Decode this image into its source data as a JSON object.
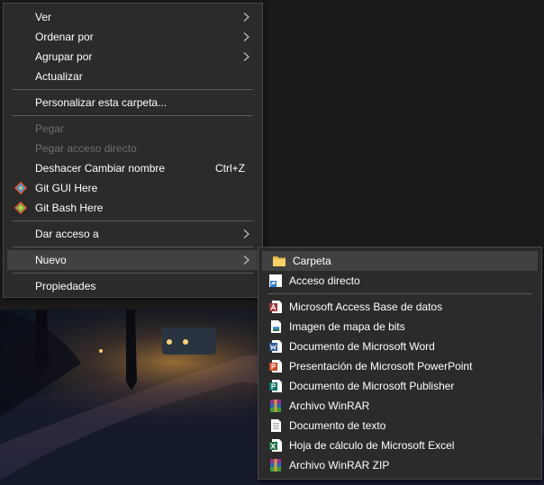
{
  "main_menu": {
    "ver": "Ver",
    "ordenar_por": "Ordenar por",
    "agrupar_por": "Agrupar por",
    "actualizar": "Actualizar",
    "personalizar": "Personalizar esta carpeta...",
    "pegar": "Pegar",
    "pegar_acceso_directo": "Pegar acceso directo",
    "deshacer": "Deshacer Cambiar nombre",
    "deshacer_shortcut": "Ctrl+Z",
    "git_gui": "Git GUI Here",
    "git_bash": "Git Bash Here",
    "dar_acceso": "Dar acceso a",
    "nuevo": "Nuevo",
    "propiedades": "Propiedades"
  },
  "submenu": {
    "carpeta": "Carpeta",
    "acceso_directo": "Acceso directo",
    "access": "Microsoft Access Base de datos",
    "bitmap": "Imagen de mapa de bits",
    "word": "Documento de Microsoft Word",
    "powerpoint": "Presentación de Microsoft PowerPoint",
    "publisher": "Documento de Microsoft Publisher",
    "winrar": "Archivo WinRAR",
    "texto": "Documento de texto",
    "excel": "Hoja de cálculo de Microsoft Excel",
    "winrar_zip": "Archivo WinRAR ZIP"
  },
  "colors": {
    "menu_bg": "#2b2b2b",
    "highlight": "#414141",
    "disabled_text": "#6d6d6d"
  }
}
